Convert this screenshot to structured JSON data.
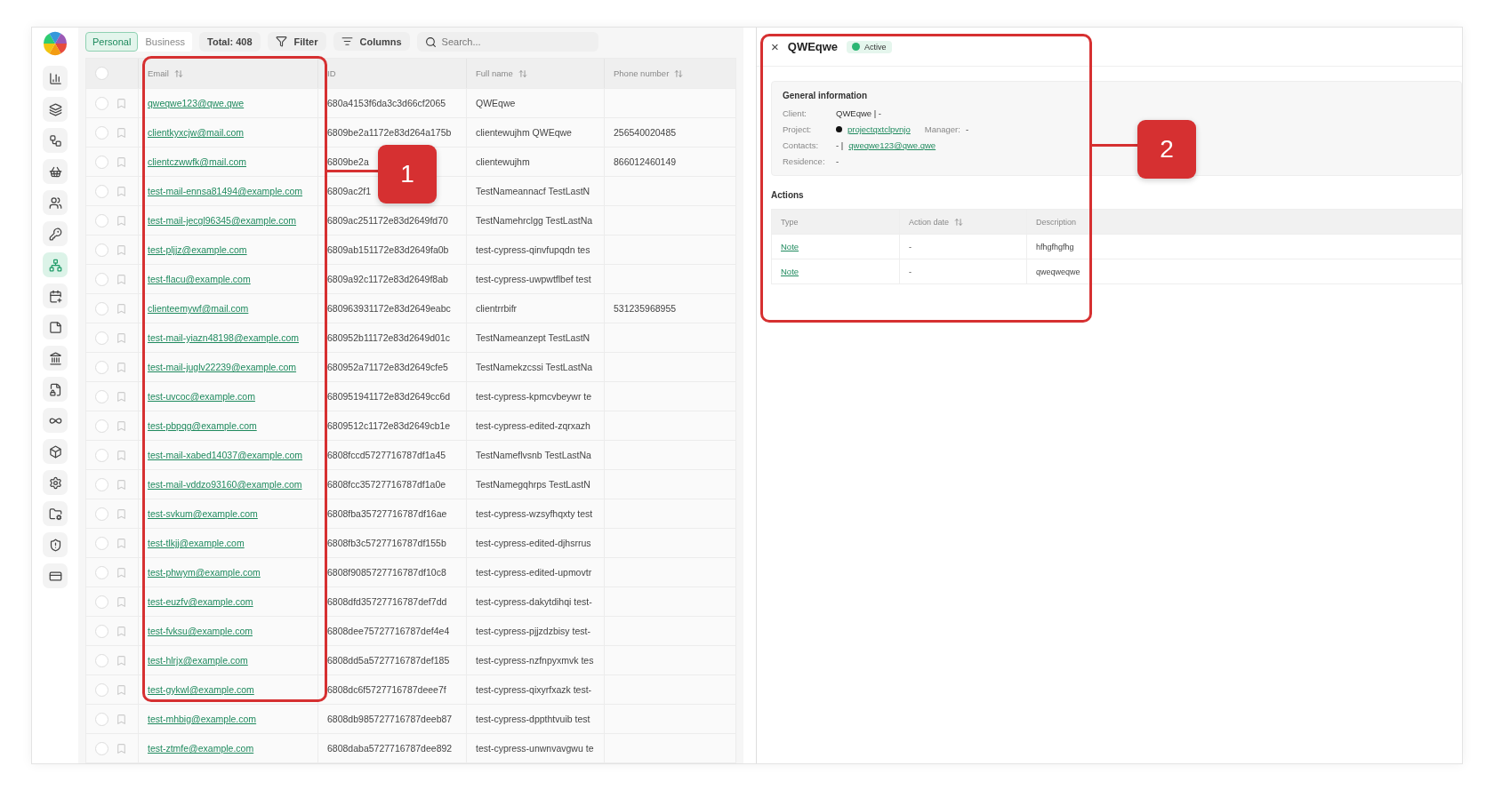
{
  "sidebar": {
    "items": [
      {
        "selected": false
      },
      {
        "selected": false
      },
      {
        "selected": false
      },
      {
        "selected": false
      },
      {
        "selected": false
      },
      {
        "selected": false
      },
      {
        "selected": true
      },
      {
        "selected": false
      },
      {
        "selected": false
      },
      {
        "selected": false
      },
      {
        "selected": false
      },
      {
        "selected": false
      },
      {
        "selected": false
      },
      {
        "selected": false
      },
      {
        "selected": false
      },
      {
        "selected": false
      },
      {
        "selected": false
      }
    ]
  },
  "toolbar": {
    "tabs": [
      {
        "label": "Personal",
        "selected": true
      },
      {
        "label": "Business",
        "selected": false
      }
    ],
    "total": "Total: 408",
    "filter": "Filter",
    "columns": "Columns",
    "search": {
      "placeholder": "Search..."
    }
  },
  "table": {
    "select_all": {
      "checked": false
    },
    "columns": [
      {
        "label": "Email",
        "sortable": true
      },
      {
        "label": "ID",
        "sortable": false
      },
      {
        "label": "Full name",
        "sortable": true
      },
      {
        "label": "Phone number",
        "sortable": true
      }
    ],
    "rows": [
      {
        "checked": false,
        "email": "qweqwe123@qwe.qwe",
        "id": "680a4153f6da3c3d66cf2065",
        "full_name": "QWEqwe",
        "phone": ""
      },
      {
        "checked": false,
        "email": "clientkyxcjw@mail.com",
        "id": "6809be2a1172e83d264a175b",
        "full_name": "clientewujhm QWEqwe",
        "phone": "256540020485"
      },
      {
        "checked": false,
        "email": "clientczwwfk@mail.com",
        "id": "6809be2a",
        "full_name": "clientewujhm",
        "phone": "866012460149"
      },
      {
        "checked": false,
        "email": "test-mail-ennsa81494@example.com",
        "id": "6809ac2f1",
        "full_name": "TestNameannacf TestLastN",
        "phone": ""
      },
      {
        "checked": false,
        "email": "test-mail-jecgl96345@example.com",
        "id": "6809ac251172e83d2649fd70",
        "full_name": "TestNamehrclgg TestLastNa",
        "phone": ""
      },
      {
        "checked": false,
        "email": "test-pljjz@example.com",
        "id": "6809ab151172e83d2649fa0b",
        "full_name": "test-cypress-qinvfupqdn tes",
        "phone": ""
      },
      {
        "checked": false,
        "email": "test-flacu@example.com",
        "id": "6809a92c1172e83d2649f8ab",
        "full_name": "test-cypress-uwpwtflbef test",
        "phone": ""
      },
      {
        "checked": false,
        "email": "clienteemywf@mail.com",
        "id": "680963931172e83d2649eabc",
        "full_name": "clientrrbifr",
        "phone": "531235968955"
      },
      {
        "checked": false,
        "email": "test-mail-yiazn48198@example.com",
        "id": "680952b11172e83d2649d01c",
        "full_name": "TestNameanzept TestLastN",
        "phone": ""
      },
      {
        "checked": false,
        "email": "test-mail-juglv22239@example.com",
        "id": "680952a71172e83d2649cfe5",
        "full_name": "TestNamekzcssi TestLastNa",
        "phone": ""
      },
      {
        "checked": false,
        "email": "test-uvcoc@example.com",
        "id": "680951941172e83d2649cc6d",
        "full_name": "test-cypress-kpmcvbeywr te",
        "phone": ""
      },
      {
        "checked": false,
        "email": "test-pbpqg@example.com",
        "id": "6809512c1172e83d2649cb1e",
        "full_name": "test-cypress-edited-zqrxazh",
        "phone": ""
      },
      {
        "checked": false,
        "email": "test-mail-xabed14037@example.com",
        "id": "6808fccd5727716787df1a45",
        "full_name": "TestNameflvsnb TestLastNa",
        "phone": ""
      },
      {
        "checked": false,
        "email": "test-mail-vddzo93160@example.com",
        "id": "6808fcc35727716787df1a0e",
        "full_name": "TestNamegqhrps TestLastN",
        "phone": ""
      },
      {
        "checked": false,
        "email": "test-svkum@example.com",
        "id": "6808fba35727716787df16ae",
        "full_name": "test-cypress-wzsyfhqxty test",
        "phone": ""
      },
      {
        "checked": false,
        "email": "test-tlkjj@example.com",
        "id": "6808fb3c5727716787df155b",
        "full_name": "test-cypress-edited-djhsrrus",
        "phone": ""
      },
      {
        "checked": false,
        "email": "test-phwym@example.com",
        "id": "6808f9085727716787df10c8",
        "full_name": "test-cypress-edited-upmovtr",
        "phone": ""
      },
      {
        "checked": false,
        "email": "test-euzfv@example.com",
        "id": "6808dfd35727716787def7dd",
        "full_name": "test-cypress-dakytdihqi test-",
        "phone": ""
      },
      {
        "checked": false,
        "email": "test-fvksu@example.com",
        "id": "6808dee75727716787def4e4",
        "full_name": "test-cypress-pjjzdzbisy test-",
        "phone": ""
      },
      {
        "checked": false,
        "email": "test-hlrjx@example.com",
        "id": "6808dd5a5727716787def185",
        "full_name": "test-cypress-nzfnpyxmvk tes",
        "phone": ""
      },
      {
        "checked": false,
        "email": "test-gykwl@example.com",
        "id": "6808dc6f5727716787deee7f",
        "full_name": "test-cypress-qixyrfxazk test-",
        "phone": ""
      },
      {
        "checked": false,
        "email": "test-mhbig@example.com",
        "id": "6808db985727716787deeb87",
        "full_name": "test-cypress-dppthtvuib test",
        "phone": ""
      },
      {
        "checked": false,
        "email": "test-ztmfe@example.com",
        "id": "6808daba5727716787dee892",
        "full_name": "test-cypress-unwnvavgwu te",
        "phone": ""
      }
    ]
  },
  "detail": {
    "close": "×",
    "title": "QWEqwe",
    "status": {
      "label": "Active",
      "color": "#2bb673"
    },
    "general": {
      "heading": "General information",
      "client_label": "Client:",
      "client": "QWEqwe | -",
      "project_label": "Project:",
      "project": "projectqxtclpvnjo",
      "manager_label": "Manager:",
      "manager": "-",
      "contacts_label": "Contacts:",
      "contacts_prefix": "- |",
      "contacts_email": "qweqwe123@qwe.qwe",
      "residence_label": "Residence:",
      "residence": "-"
    },
    "actions": {
      "heading": "Actions",
      "columns": [
        {
          "label": "Type",
          "sortable": false
        },
        {
          "label": "Action date",
          "sortable": true
        },
        {
          "label": "Description",
          "sortable": false
        }
      ],
      "rows": [
        {
          "type": "Note",
          "date": "-",
          "description": "hfhgfhgfhg"
        },
        {
          "type": "Note",
          "date": "-",
          "description": "qweqweqwe"
        }
      ]
    }
  },
  "annotations": [
    {
      "label": "1"
    },
    {
      "label": "2"
    }
  ]
}
